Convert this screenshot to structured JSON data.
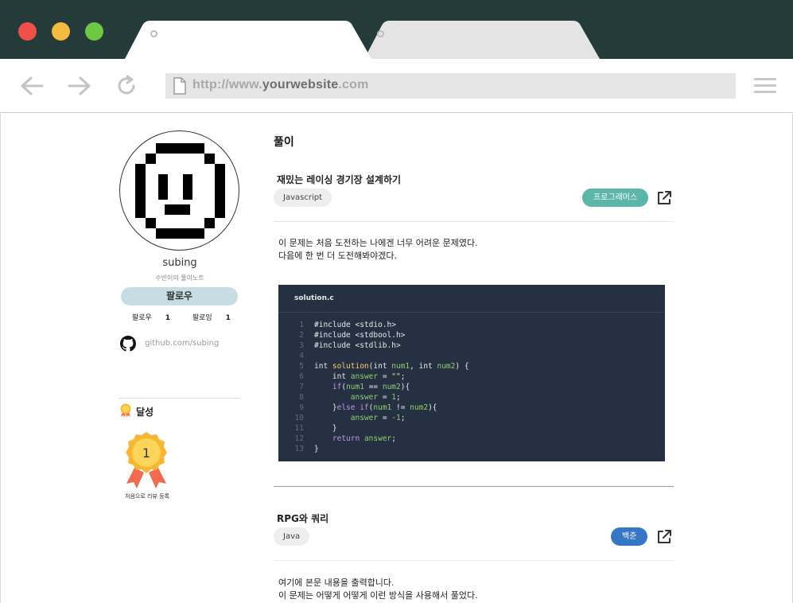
{
  "browser": {
    "url_prefix": "http://www.",
    "url_domain": "yourwebsite",
    "url_suffix": ".com",
    "traffic_colors": [
      "#f1504a",
      "#f4bb3f",
      "#6cc941"
    ],
    "tabs": [
      "active-tab",
      "inactive-tab"
    ]
  },
  "sidebar": {
    "username": "subing",
    "bio": "수빈이의 풀이노트",
    "follow_label": "팔로우",
    "followers_label": "팔로우",
    "followers_count": "1",
    "following_label": "팔로잉",
    "following_count": "1",
    "github_link": "github.com/subing",
    "achievements_title": "달성",
    "medal_number": "1",
    "medal_caption": "처음으로 리뷰 등록"
  },
  "main": {
    "section_title": "풀이",
    "posts": [
      {
        "title": "재밌는 레이싱 경기장 설계하기",
        "language": "Javascript",
        "source": "프로그래머스",
        "source_color": "#5bb5a9",
        "body": [
          "이 문제는 처음 도전하는 나에겐 너무 어려운 문제였다.",
          "다음에 한 번 더 도전해봐야겠다."
        ],
        "code_filename": "solution.c"
      },
      {
        "title": "RPG와 쿼리",
        "language": "Java",
        "source": "백준",
        "source_color": "#3577c4",
        "body": [
          "여기에 본문 내용을 출력합니다.",
          "이 문제는 어떻게 어떻게 이런 방식을 사용해서 풀었다."
        ]
      }
    ]
  },
  "code": [
    {
      "n": "1",
      "html": "#include &lt;stdio.h&gt;"
    },
    {
      "n": "2",
      "html": "#include &lt;stdbool.h&gt;"
    },
    {
      "n": "3",
      "html": "#include &lt;stdlib.h&gt;"
    },
    {
      "n": "4",
      "html": ""
    },
    {
      "n": "5",
      "html": "int <span class=\"f\">solution</span>(int <span class=\"v\">num1</span>, int <span class=\"v\">num2</span>) {"
    },
    {
      "n": "6",
      "html": "    int <span class=\"v\">answer</span> = <span class=\"s\">\"\"</span>;"
    },
    {
      "n": "7",
      "html": "    <span class=\"k\">if</span>(<span class=\"v\">num1</span> == <span class=\"v\">num2</span>){"
    },
    {
      "n": "8",
      "html": "        <span class=\"v\">answer</span> = <span class=\"v\">1</span>;"
    },
    {
      "n": "9",
      "html": "    }<span class=\"k\">else if</span>(<span class=\"v\">num1</span> != <span class=\"v\">num2</span>){"
    },
    {
      "n": "10",
      "html": "        <span class=\"v\">answer</span> = <span class=\"v\">-1</span>;"
    },
    {
      "n": "11",
      "html": "    }"
    },
    {
      "n": "12",
      "html": "    <span class=\"k\">return</span> <span class=\"v\">answer</span>;"
    },
    {
      "n": "13",
      "html": "}"
    }
  ]
}
